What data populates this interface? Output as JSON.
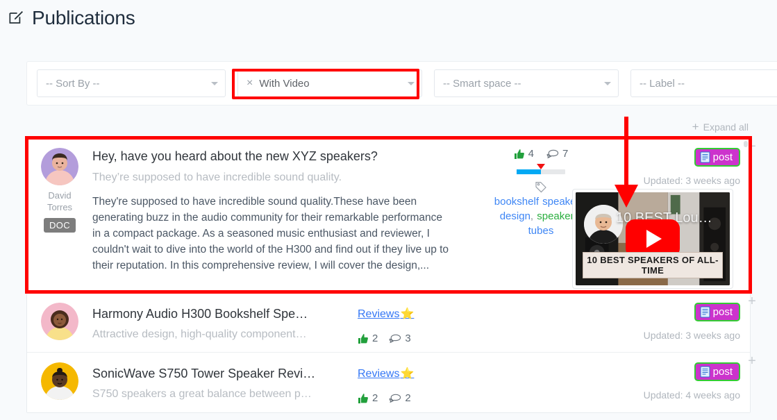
{
  "header": {
    "title": "Publications",
    "icon": "pencil-square-icon"
  },
  "filters": {
    "sort_by": "-- Sort By --",
    "with_video": "With Video",
    "with_video_clear": "×",
    "smart_space": "-- Smart space --",
    "label": "-- Label --"
  },
  "toolbar": {
    "expand_all": "Expand all",
    "expand_all_icon": "plus-icon"
  },
  "rows": [
    {
      "author": "David Torres",
      "author_first": "David",
      "author_last": "Torres",
      "type_badge": "DOC",
      "title": "Hey, have you heard about the new XYZ speakers?",
      "subtitle": "They’re supposed to have incredible sound quality.",
      "body": "They're supposed to have incredible sound quality.These have been generating buzz in the audio community for their remarkable performance in a compact package. As a seasoned music enthusiast and reviewer, I couldn't wait to dive into the world of the H300 and find out if they live up to their reputation. In this comprehensive review, I will cover the design,...",
      "likes": "4",
      "comments": "7",
      "progress_percent": 50,
      "tags": [
        {
          "text": "bookshelf speakers",
          "color": "#3e86f5"
        },
        {
          "text": "design",
          "color": "#3e86f5"
        },
        {
          "text": "speakers",
          "color": "#2aae3f"
        },
        {
          "text": "tubes",
          "color": "#3e86f5"
        }
      ],
      "video": {
        "overlay_title": "10 BEST Lou…",
        "caption": "10 BEST SPEAKERS OF ALL-TIME"
      },
      "post_badge": "post",
      "updated": "Updated: 3 weeks ago",
      "toggle": "−"
    },
    {
      "author": "",
      "title": "Harmony Audio H300 Bookshelf Spe…",
      "subtitle": "Attractive design, high-quality component…",
      "link_label": "Reviews",
      "link_star": "⭐",
      "likes": "2",
      "comments": "3",
      "post_badge": "post",
      "updated": "Updated: 3 weeks ago",
      "toggle": "+"
    },
    {
      "author": "",
      "title": "SonicWave S750 Tower Speaker Revi…",
      "subtitle": "S750 speakers a great balance between p…",
      "link_label": "Reviews",
      "link_star": "⭐",
      "likes": "2",
      "comments": "2",
      "post_badge": "post",
      "updated": "Updated: 4 weeks ago",
      "toggle": "+"
    }
  ],
  "colors": {
    "annotation": "#ff0000",
    "link": "#3477f5",
    "badge_bg": "#cc33cc",
    "badge_border": "#33cc33",
    "progress": "#03a9f4",
    "tag_green": "#2aae3f"
  }
}
